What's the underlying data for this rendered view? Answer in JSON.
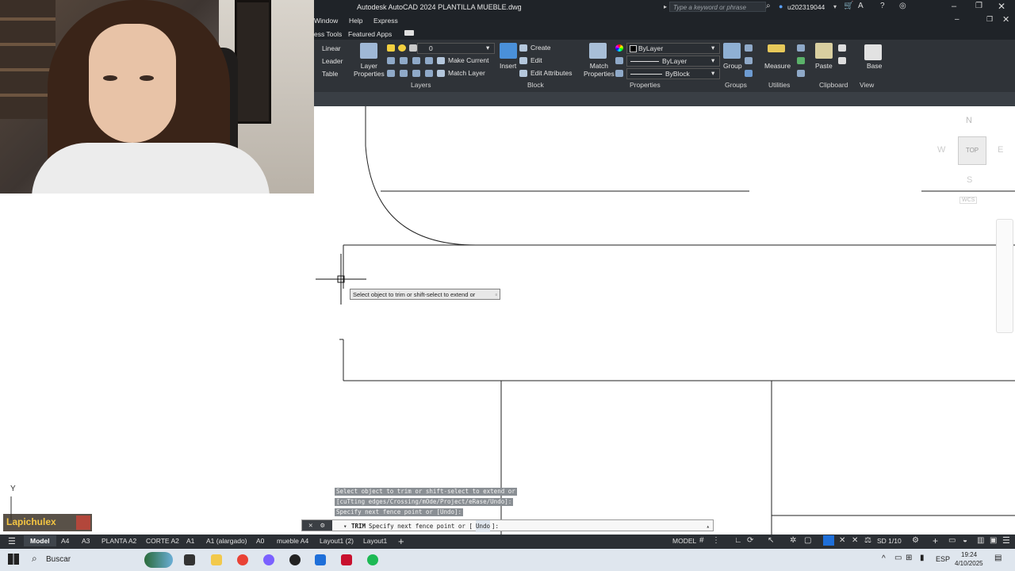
{
  "app": {
    "title": "Autodesk AutoCAD 2024   PLANTILLA MUEBLE.dwg",
    "search_placeholder": "Type a keyword or phrase",
    "user": "u202319044",
    "accent": "#1e6fd9"
  },
  "menu": [
    "Window",
    "Help",
    "Express"
  ],
  "ribbon_tabs": [
    "ess Tools",
    "Featured Apps"
  ],
  "ribbon": {
    "annotation": [
      "Linear",
      "Leader",
      "Table"
    ],
    "layer_properties": "Layer\nProperties",
    "layer_current": "0",
    "make_current": "Make Current",
    "match_layer": "Match Layer",
    "insert": "Insert",
    "block_create": "Create",
    "block_edit": "Edit",
    "edit_attributes": "Edit Attributes",
    "match_properties": "Match\nProperties",
    "color": "ByLayer",
    "linetype": "ByLayer",
    "lineweight": "ByBlock",
    "group": "Group",
    "measure": "Measure",
    "paste": "Paste",
    "base": "Base",
    "panels": {
      "layers": "Layers",
      "block": "Block",
      "properties": "Properties",
      "groups": "Groups",
      "utilities": "Utilities",
      "clipboard": "Clipboard",
      "view": "View"
    }
  },
  "viewcube": {
    "north": "N",
    "south": "S",
    "east": "E",
    "west": "W",
    "face": "TOP",
    "wcs": "WCS"
  },
  "tooltip": "Select object to trim or shift-select to extend or",
  "command_history": [
    "Select object to trim or shift-select to extend or",
    "[cuTting edges/Crossing/mOde/Project/eRase/Undo]:",
    "Specify next fence point or [Undo]:"
  ],
  "command_line": {
    "command": "TRIM",
    "prompt": "Specify next fence point or [",
    "option": "Undo",
    "suffix": "]:"
  },
  "ucs_label": "Y",
  "streamer_overlay": "Lapichulex",
  "layout_tabs": [
    "Model",
    "A4",
    "A3",
    "PLANTA A2",
    "CORTE A2",
    "A1",
    "A1 (alargado)",
    "A0",
    "mueble A4",
    "Layout1 (2)",
    "Layout1"
  ],
  "status": {
    "model": "MODEL",
    "scale": "SD 1/10",
    "language": "ESP",
    "time": "19:24",
    "date": "4/10/2025"
  },
  "taskbar": {
    "search": "Buscar"
  }
}
